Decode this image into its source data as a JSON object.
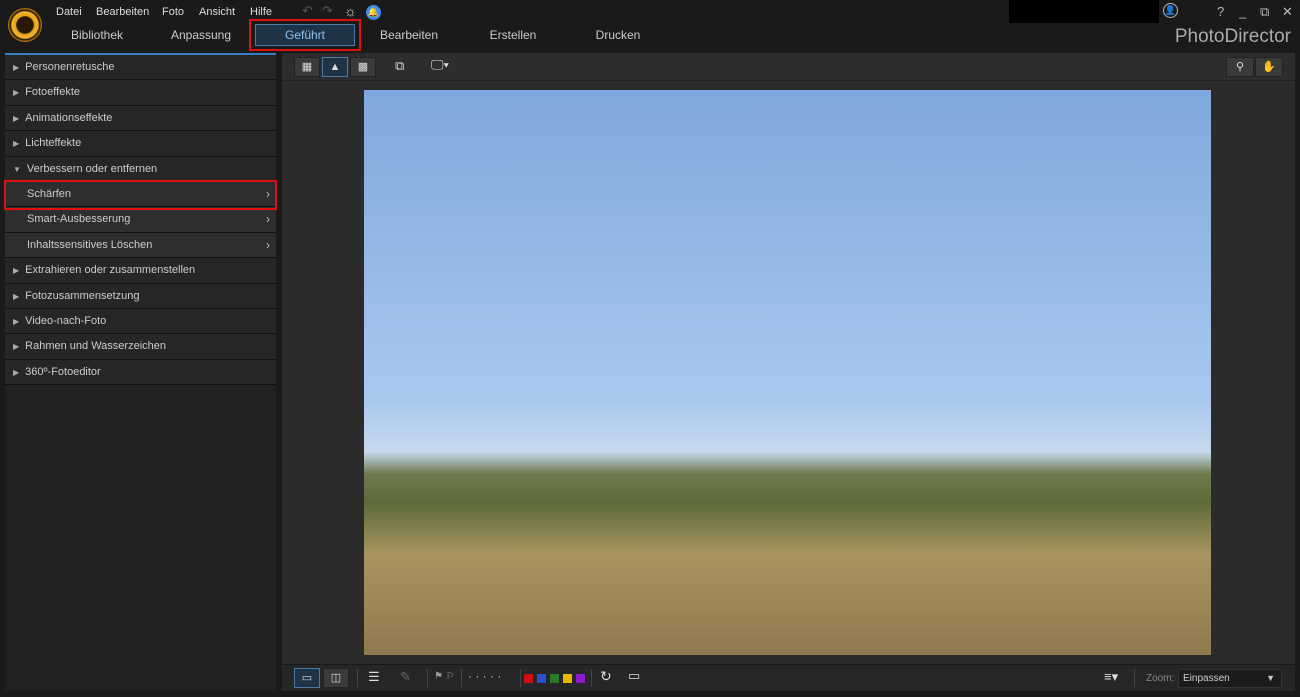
{
  "menu": [
    "Datei",
    "Bearbeiten",
    "Foto",
    "Ansicht",
    "Hilfe"
  ],
  "tabs": [
    "Bibliothek",
    "Anpassung",
    "Geführt",
    "Bearbeiten",
    "Erstellen",
    "Drucken"
  ],
  "active_tab": "Geführt",
  "brand": "PhotoDirector",
  "window_controls": {
    "help": "?",
    "minimize": "_",
    "restore": "⧉",
    "close": "✕"
  },
  "sidebar": {
    "items": [
      {
        "label": "Personenretusche",
        "type": "group"
      },
      {
        "label": "Fotoeffekte",
        "type": "group"
      },
      {
        "label": "Animationseffekte",
        "type": "group"
      },
      {
        "label": "Lichteffekte",
        "type": "group"
      },
      {
        "label": "Verbessern oder entfernen",
        "type": "group-open"
      },
      {
        "label": "Schärfen",
        "type": "sub",
        "selected": true
      },
      {
        "label": "Smart-Ausbesserung",
        "type": "sub"
      },
      {
        "label": "Inhaltssensitives Löschen",
        "type": "sub"
      },
      {
        "label": "Extrahieren oder zusammenstellen",
        "type": "group"
      },
      {
        "label": "Fotozusammensetzung",
        "type": "group"
      },
      {
        "label": "Video-nach-Foto",
        "type": "group"
      },
      {
        "label": "Rahmen und Wasserzeichen",
        "type": "group"
      },
      {
        "label": "360º-Fotoeditor",
        "type": "group"
      }
    ]
  },
  "bottom": {
    "zoom_label": "Zoom:",
    "zoom_value": "Einpassen",
    "flags": "⚑ ⚐",
    "rating": "· · · · ·",
    "color_labels": [
      "#d01010",
      "#2a50d0",
      "#2a7a2a",
      "#e8b800",
      "#8a1ad0"
    ]
  },
  "colors": {
    "accent": "#3a7fc4",
    "highlight": "#d11111"
  }
}
